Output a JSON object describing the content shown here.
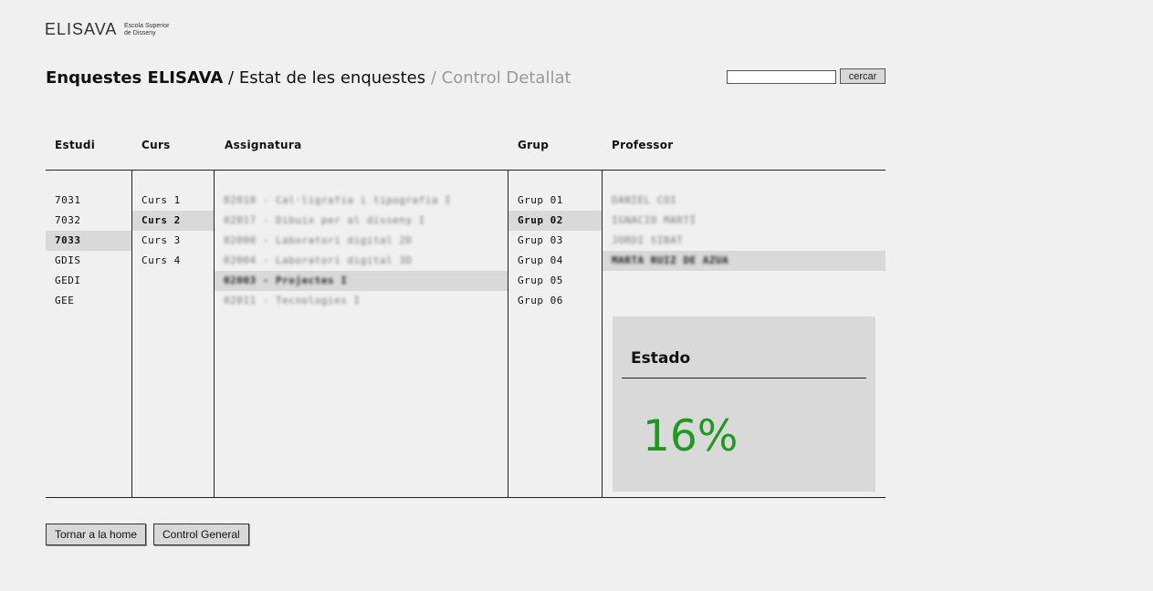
{
  "logo": {
    "wordmark": "ELISAVA",
    "sub_line1": "Escola Superior",
    "sub_line2": "de Disseny"
  },
  "title": {
    "part1": "Enquestes ELISAVA",
    "part2": " / Estat de les enquestes",
    "part3": " / Control Detallat"
  },
  "search": {
    "value": "",
    "button_label": "cercar"
  },
  "columns": {
    "estudi": "Estudi",
    "curs": "Curs",
    "assignatura": "Assignatura",
    "grup": "Grup",
    "professor": "Professor"
  },
  "estudi_items": [
    "7031",
    "7032",
    "7033",
    "GDIS",
    "GEDI",
    "GEE"
  ],
  "curs_items": [
    "Curs 1",
    "Curs 2",
    "Curs 3",
    "Curs 4"
  ],
  "assignatura_items": [
    "02010 - Cal·ligrafia i tipografia I",
    "02017 - Dibuix per al disseny I",
    "02000 - Laboratori digital 2D",
    "02004 - Laboratori digital 3D",
    "02003 - Projectes I",
    "02011 - Tecnologies I"
  ],
  "grup_items": [
    "Grup 01",
    "Grup 02",
    "Grup 03",
    "Grup 04",
    "Grup 05",
    "Grup 06"
  ],
  "professor_items": [
    "DANIEL COI",
    "IGNACIO MARTÍ",
    "JORDI SIBAT",
    "MARTA RUIZ DE AZUA"
  ],
  "estado": {
    "title": "Estado",
    "percent": "16%",
    "color": "#1f9a1f"
  },
  "footer": {
    "home_label": "Tornar a la home",
    "general_label": "Control General"
  }
}
